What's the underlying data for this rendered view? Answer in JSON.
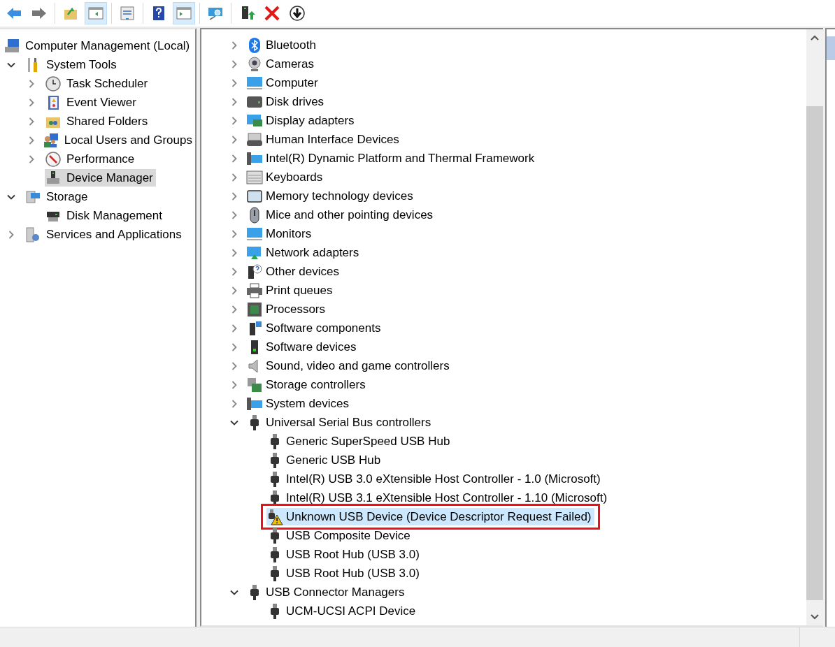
{
  "toolbar": {
    "groups": [
      [
        {
          "kind": "back",
          "pressed": false
        },
        {
          "kind": "forward",
          "pressed": false
        }
      ],
      [
        {
          "kind": "up",
          "pressed": false
        },
        {
          "kind": "tree",
          "pressed": true
        }
      ],
      [
        {
          "kind": "properties",
          "pressed": false
        }
      ],
      [
        {
          "kind": "help",
          "pressed": false
        },
        {
          "kind": "action",
          "pressed": true
        }
      ],
      [
        {
          "kind": "scan",
          "pressed": false
        }
      ],
      [
        {
          "kind": "enable",
          "pressed": false
        },
        {
          "kind": "uninstall",
          "pressed": false
        },
        {
          "kind": "download",
          "pressed": false
        }
      ]
    ]
  },
  "console_tree": {
    "items": [
      {
        "label": "Computer Management (Local)",
        "kind": "computer-mgmt",
        "selected": false,
        "children": [
          {
            "label": "System Tools",
            "kind": "tools",
            "expanded": true,
            "selected": false,
            "children": [
              {
                "label": "Task Scheduler",
                "kind": "clock",
                "expanded": false,
                "selected": false
              },
              {
                "label": "Event Viewer",
                "kind": "event",
                "expanded": false,
                "selected": false
              },
              {
                "label": "Shared Folders",
                "kind": "shared",
                "expanded": false,
                "selected": false
              },
              {
                "label": "Local Users and Groups",
                "kind": "users",
                "expanded": false,
                "selected": false
              },
              {
                "label": "Performance",
                "kind": "gauge",
                "expanded": false,
                "selected": false
              },
              {
                "label": "Device Manager",
                "kind": "devmgr",
                "selected": true
              }
            ]
          },
          {
            "label": "Storage",
            "kind": "storage",
            "expanded": true,
            "selected": false,
            "children": [
              {
                "label": "Disk Management",
                "kind": "diskmgmt",
                "selected": false
              }
            ]
          },
          {
            "label": "Services and Applications",
            "kind": "services",
            "expanded": false,
            "selected": false
          }
        ]
      }
    ]
  },
  "device_tree": {
    "categories": [
      {
        "label": "Bluetooth",
        "kind": "bluetooth",
        "expanded": false
      },
      {
        "label": "Cameras",
        "kind": "camera",
        "expanded": false
      },
      {
        "label": "Computer",
        "kind": "monitor",
        "expanded": false
      },
      {
        "label": "Disk drives",
        "kind": "disk",
        "expanded": false
      },
      {
        "label": "Display adapters",
        "kind": "display",
        "expanded": false
      },
      {
        "label": "Human Interface Devices",
        "kind": "hid",
        "expanded": false
      },
      {
        "label": "Intel(R) Dynamic Platform and Thermal Framework",
        "kind": "pc",
        "expanded": false
      },
      {
        "label": "Keyboards",
        "kind": "keyboard",
        "expanded": false
      },
      {
        "label": "Memory technology devices",
        "kind": "memory",
        "expanded": false
      },
      {
        "label": "Mice and other pointing devices",
        "kind": "mouse",
        "expanded": false
      },
      {
        "label": "Monitors",
        "kind": "monitor",
        "expanded": false
      },
      {
        "label": "Network adapters",
        "kind": "network",
        "expanded": false
      },
      {
        "label": "Other devices",
        "kind": "other",
        "expanded": false
      },
      {
        "label": "Print queues",
        "kind": "printer",
        "expanded": false
      },
      {
        "label": "Processors",
        "kind": "chip",
        "expanded": false
      },
      {
        "label": "Software components",
        "kind": "softcomp",
        "expanded": false
      },
      {
        "label": "Software devices",
        "kind": "softdev",
        "expanded": false
      },
      {
        "label": "Sound, video and game controllers",
        "kind": "speaker",
        "expanded": false
      },
      {
        "label": "Storage controllers",
        "kind": "storagectl",
        "expanded": false
      },
      {
        "label": "System devices",
        "kind": "pc",
        "expanded": false
      },
      {
        "label": "Universal Serial Bus controllers",
        "kind": "usb",
        "expanded": true,
        "children": [
          {
            "label": "Generic SuperSpeed USB Hub",
            "selected": false,
            "warning": false,
            "annotated": false
          },
          {
            "label": "Generic USB Hub",
            "selected": false,
            "warning": false,
            "annotated": false
          },
          {
            "label": "Intel(R) USB 3.0 eXtensible Host Controller - 1.0 (Microsoft)",
            "selected": false,
            "warning": false,
            "annotated": false
          },
          {
            "label": "Intel(R) USB 3.1 eXtensible Host Controller - 1.10 (Microsoft)",
            "selected": false,
            "warning": false,
            "annotated": false
          },
          {
            "label": "Unknown USB Device (Device Descriptor Request Failed)",
            "selected": true,
            "warning": true,
            "annotated": true
          },
          {
            "label": "USB Composite Device",
            "selected": false,
            "warning": false,
            "annotated": false
          },
          {
            "label": "USB Root Hub (USB 3.0)",
            "selected": false,
            "warning": false,
            "annotated": false
          },
          {
            "label": "USB Root Hub (USB 3.0)",
            "selected": false,
            "warning": false,
            "annotated": false
          }
        ]
      },
      {
        "label": "USB Connector Managers",
        "kind": "usb",
        "expanded": true,
        "children": [
          {
            "label": "UCM-UCSI ACPI Device",
            "selected": false,
            "warning": false,
            "annotated": false
          }
        ]
      }
    ]
  }
}
